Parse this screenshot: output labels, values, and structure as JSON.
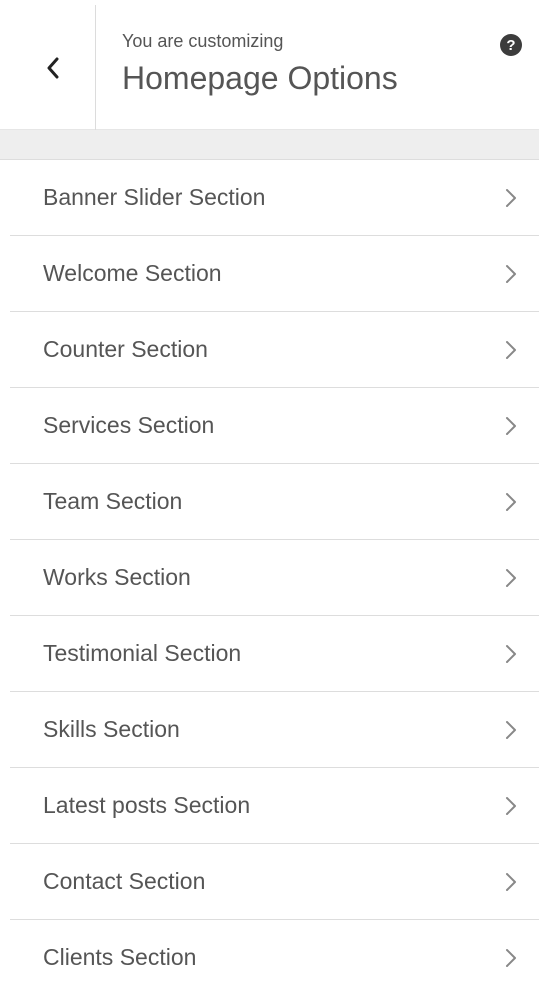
{
  "header": {
    "back_icon": "chevron-left-icon",
    "customizing_label": "You are customizing",
    "title": "Homepage Options",
    "help_glyph": "?",
    "help_icon": "help-icon"
  },
  "sections": [
    {
      "label": "Banner Slider Section"
    },
    {
      "label": "Welcome Section"
    },
    {
      "label": "Counter Section"
    },
    {
      "label": "Services Section"
    },
    {
      "label": "Team Section"
    },
    {
      "label": "Works Section"
    },
    {
      "label": "Testimonial Section"
    },
    {
      "label": "Skills Section"
    },
    {
      "label": "Latest posts Section"
    },
    {
      "label": "Contact Section"
    },
    {
      "label": "Clients Section"
    }
  ],
  "colors": {
    "text": "#555555",
    "divider": "#dddddd",
    "strip": "#eeeeee",
    "help_bg": "#3c3c3c"
  }
}
